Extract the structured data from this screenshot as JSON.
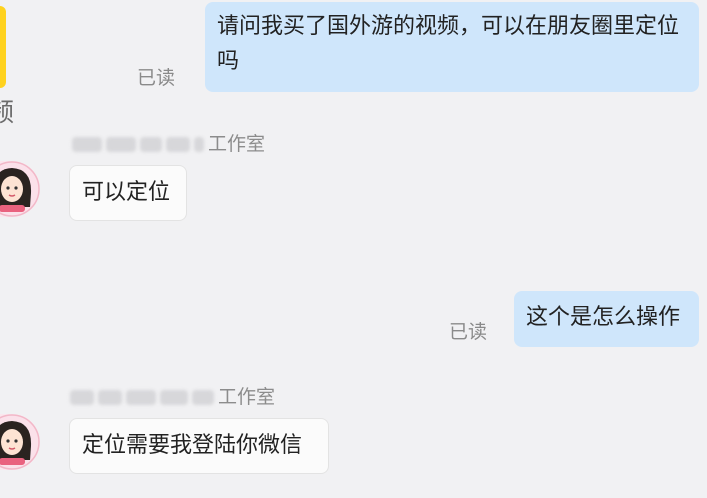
{
  "thread": {
    "left_edge_text": "频",
    "messages": [
      {
        "direction": "out",
        "text": "请问我买了国外游的视频，可以在朋友圈里定位吗",
        "status": "已读"
      },
      {
        "direction": "in",
        "sender_suffix": "工作室",
        "text": "可以定位"
      },
      {
        "direction": "out",
        "text": "这个是怎么操作",
        "status": "已读"
      },
      {
        "direction": "in",
        "sender_suffix": "工作室",
        "text": "定位需要我登陆你微信"
      }
    ]
  },
  "colors": {
    "background": "#f1f1f3",
    "outgoing_bubble": "#cfe6fb",
    "incoming_bubble": "#fbfbfb",
    "status_text": "#8a8a8a"
  },
  "icons": {
    "avatar": "girl-avatar-icon"
  }
}
